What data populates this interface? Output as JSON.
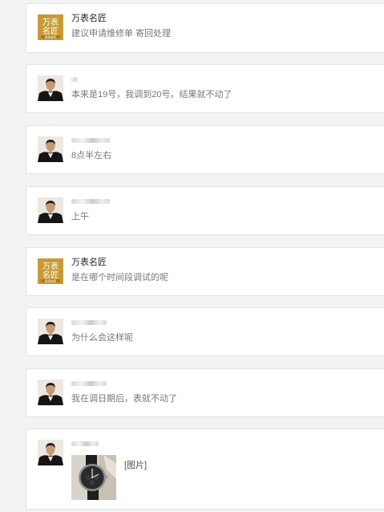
{
  "brand_avatar": {
    "line1": "万表",
    "line2": "名匠",
    "line3": "腕表维修"
  },
  "messages": [
    {
      "sender": "万表名匠",
      "avatar": "brand",
      "text": "建议申请维修单 寄回处理"
    },
    {
      "sender": "",
      "avatar": "person",
      "text": "本来是19号，我调到20号。结果就不动了"
    },
    {
      "sender": "",
      "avatar": "person",
      "text": "8点半左右"
    },
    {
      "sender": "",
      "avatar": "person",
      "text": "上午"
    },
    {
      "sender": "万表名匠",
      "avatar": "brand",
      "text": "是在哪个时间段调试的呢"
    },
    {
      "sender": "",
      "avatar": "person",
      "text": "为什么会这样呢"
    },
    {
      "sender": "",
      "avatar": "person",
      "text": "我在调日期后，表就不动了"
    },
    {
      "sender": "",
      "avatar": "person",
      "text": "[图片]",
      "attachment": "watch-photo"
    }
  ]
}
